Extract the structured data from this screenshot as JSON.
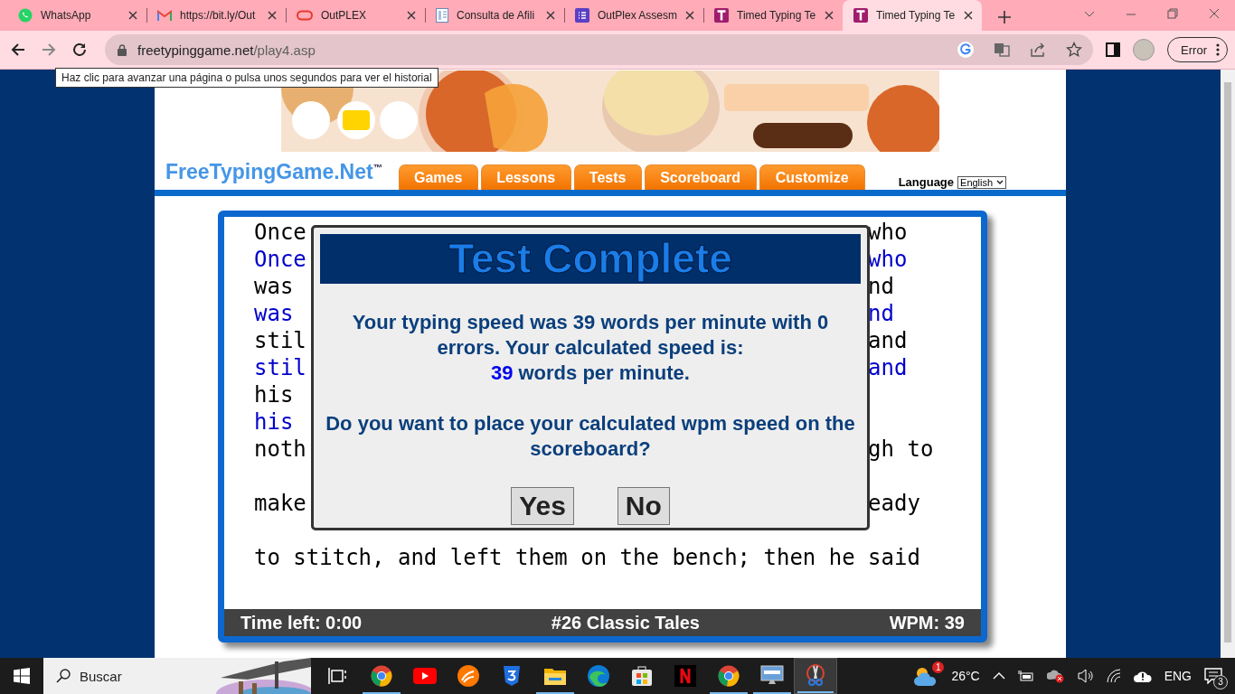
{
  "browser": {
    "tabs": [
      {
        "kind": "chat",
        "title": "WhatsApp",
        "selected": false
      },
      {
        "kind": "mail",
        "title": "https://bit.ly/Out",
        "selected": false
      },
      {
        "kind": "ring",
        "title": "OutPLEX",
        "selected": false
      },
      {
        "kind": "doc",
        "title": "Consulta de Afili",
        "selected": false
      },
      {
        "kind": "form",
        "title": "OutPlex Assesm",
        "selected": false
      },
      {
        "kind": "t",
        "title": "Timed Typing Te",
        "selected": false
      },
      {
        "kind": "t",
        "title": "Timed Typing Te",
        "selected": true
      }
    ],
    "address": {
      "host": "freetypinggame.net",
      "path": "/play4.asp"
    },
    "profile_button": "Error",
    "tooltip": "Haz clic para avanzar una página o pulsa unos segundos para ver el historial"
  },
  "site": {
    "logo": "FreeTypingGame.Net$^{™}$",
    "nav": [
      "Games",
      "Lessons",
      "Tests",
      "Scoreboard",
      "Customize"
    ],
    "language": {
      "label": "Language",
      "value": "English"
    }
  },
  "passage": [
    {
      "left": "Once",
      "right": "who",
      "typed": false
    },
    {
      "left": "Once",
      "right": "who",
      "typed": true
    },
    {
      "left": "was",
      "right": "nd",
      "typed": false
    },
    {
      "left": "was",
      "right": "nd",
      "typed": true
    },
    {
      "left": "stil",
      "right": "and",
      "typed": false
    },
    {
      "left": "stil",
      "right": "and",
      "typed": true
    },
    {
      "left": "his",
      "typed": false
    },
    {
      "left": "his",
      "typed": true
    },
    {
      "left": "noth",
      "right": "gh to",
      "typed": false
    },
    {
      "left": "make",
      "right": "eady",
      "typed": false
    },
    {
      "left": "to stitch, and left them on the bench; then he said",
      "typed": false
    }
  ],
  "status": {
    "time_left": "Time left: 0:00",
    "title": "#26 Classic Tales",
    "wpm": "WPM: 39"
  },
  "dialog": {
    "title": "Test Complete",
    "message": "Your typing speed was 39 words per minute with 0 errors. Your calculated speed is:",
    "speed": "39",
    "speed_unit": "words per minute.",
    "question": "Do you want to place your calculated wpm speed on the scoreboard?",
    "buttons": [
      "Yes",
      "No"
    ]
  },
  "taskbar": {
    "search": "Buscar",
    "apps": [
      {
        "kind": "taskview",
        "open": false,
        "selected": false
      },
      {
        "kind": "chrome",
        "open": true,
        "selected": false
      },
      {
        "kind": "youtube",
        "open": false,
        "selected": false
      },
      {
        "kind": "orange",
        "open": false,
        "selected": false
      },
      {
        "kind": "shield",
        "open": false,
        "selected": false
      },
      {
        "kind": "folder",
        "open": true,
        "selected": false
      },
      {
        "kind": "edge",
        "open": false,
        "selected": false
      },
      {
        "kind": "store",
        "open": false,
        "selected": false
      },
      {
        "kind": "tile",
        "open": false,
        "selected": false
      },
      {
        "kind": "chrome",
        "open": true,
        "selected": false
      },
      {
        "kind": "monitor",
        "open": true,
        "selected": false
      },
      {
        "kind": "snip",
        "open": true,
        "selected": true
      }
    ],
    "weather": {
      "temp": "26°C",
      "badge": "1"
    },
    "language": "ENG",
    "notifications": "3"
  }
}
